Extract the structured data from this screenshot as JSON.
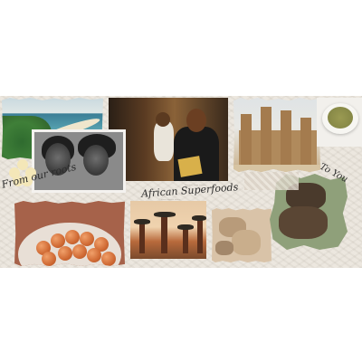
{
  "banner": {
    "phrase_left": "From our roots",
    "title": "African Superfoods",
    "phrase_right": "To You",
    "caption_1": "-------- ----- -------",
    "caption_2": "----- ------- ------",
    "caption_3": "---------- ---"
  },
  "photos": [
    {
      "name": "coastline-photo"
    },
    {
      "name": "two-women-photo"
    },
    {
      "name": "mother-and-child-photo"
    },
    {
      "name": "mud-mosque-photo"
    },
    {
      "name": "green-powder-bowl-photo"
    },
    {
      "name": "baobab-trees-photo"
    },
    {
      "name": "orange-fruits-plate-photo"
    },
    {
      "name": "roots-photo"
    },
    {
      "name": "hands-photo"
    }
  ],
  "colors": {
    "background": "#ffffff",
    "collage_paper": "#ece7df",
    "script_ink": "#2b2b2b"
  }
}
